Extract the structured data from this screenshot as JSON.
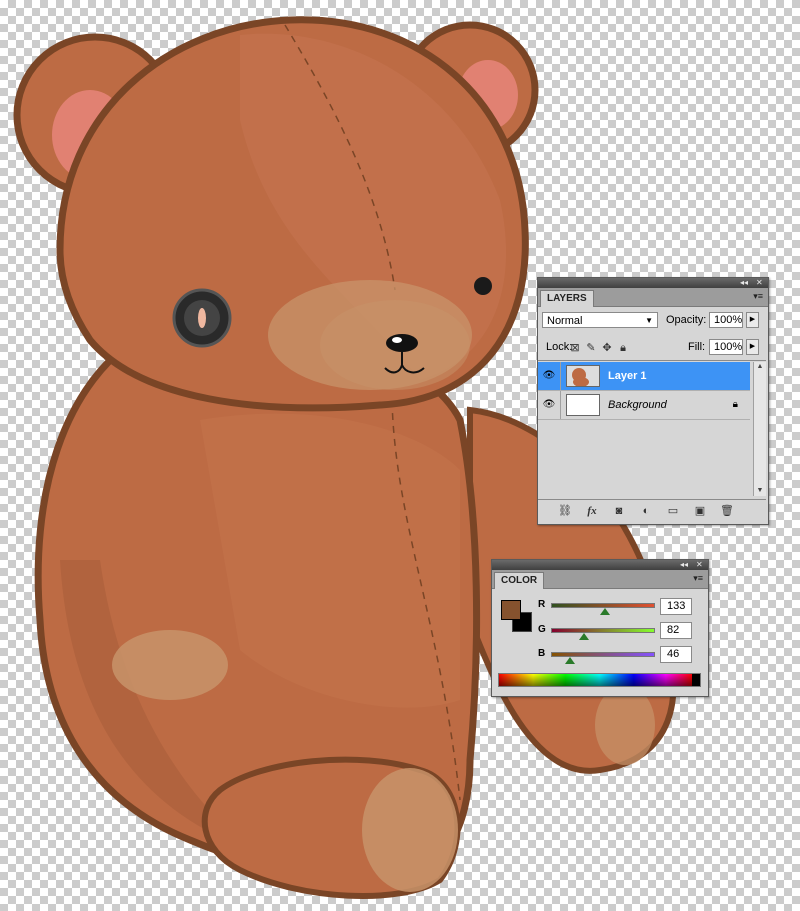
{
  "layers_panel": {
    "tab_label": "LAYERS",
    "blend_mode": "Normal",
    "opacity_label": "Opacity:",
    "opacity_value": "100%",
    "lock_label": "Lock:",
    "fill_label": "Fill:",
    "fill_value": "100%",
    "layers": [
      {
        "name": "Layer 1",
        "selected": true,
        "visible": true
      },
      {
        "name": "Background",
        "selected": false,
        "visible": true,
        "locked": true
      }
    ],
    "bottom_icons": [
      "link-icon",
      "fx-icon",
      "mask-icon",
      "adjustment-icon",
      "folder-icon",
      "new-layer-icon",
      "trash-icon"
    ]
  },
  "color_panel": {
    "tab_label": "COLOR",
    "channels": [
      {
        "label": "R",
        "value": "133",
        "fraction": 0.52
      },
      {
        "label": "G",
        "value": "82",
        "fraction": 0.32
      },
      {
        "label": "B",
        "value": "46",
        "fraction": 0.18
      }
    ],
    "foreground_color": "#85522e",
    "background_color": "#000000"
  },
  "colors": {
    "selection": "#3d93f5",
    "bear_fur": "#bd6b44",
    "bear_outline": "#7a4526",
    "bear_muzzle": "#c8936a",
    "ear_inner": "#e8857a"
  }
}
